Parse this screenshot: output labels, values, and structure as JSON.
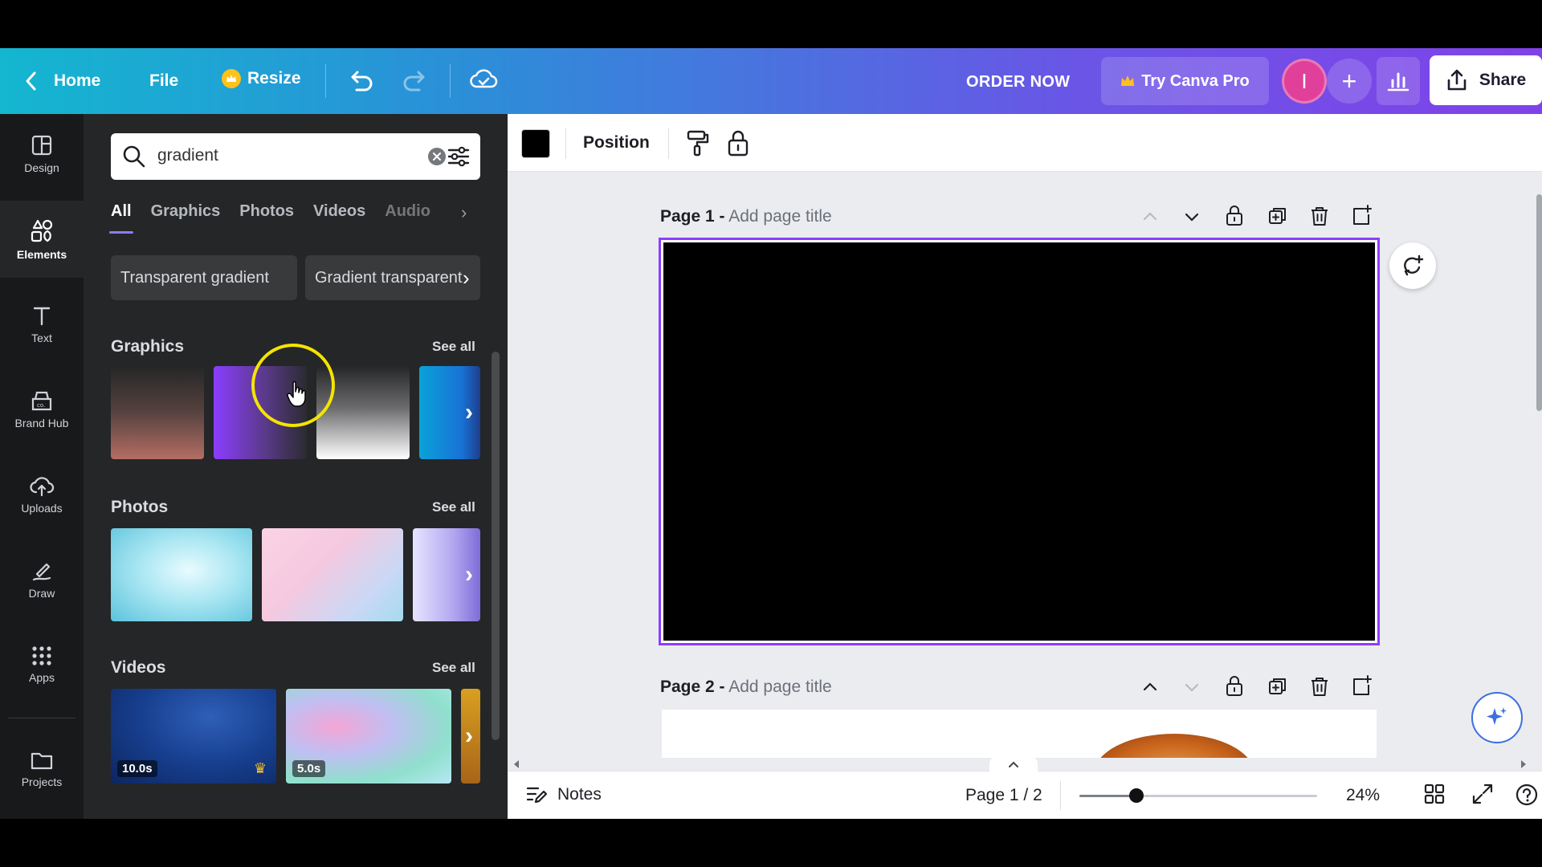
{
  "topbar": {
    "home_label": "Home",
    "file_label": "File",
    "resize_label": "Resize",
    "order_now_label": "ORDER NOW",
    "try_pro_label": "Try Canva Pro",
    "avatar_initial": "I",
    "plus_label": "+",
    "share_label": "Share"
  },
  "rail": {
    "items": [
      {
        "label": "Design",
        "icon": "layout-icon"
      },
      {
        "label": "Elements",
        "icon": "shapes-icon"
      },
      {
        "label": "Text",
        "icon": "text-icon"
      },
      {
        "label": "Brand Hub",
        "icon": "brand-icon"
      },
      {
        "label": "Uploads",
        "icon": "cloud-upload-icon"
      },
      {
        "label": "Draw",
        "icon": "pen-icon"
      },
      {
        "label": "Apps",
        "icon": "grid-icon"
      },
      {
        "label": "Projects",
        "icon": "folder-icon"
      }
    ],
    "active": "Elements"
  },
  "panel": {
    "search_value": "gradient",
    "tabs": [
      "All",
      "Graphics",
      "Photos",
      "Videos",
      "Audio"
    ],
    "active_tab": "All",
    "chips": [
      "Transparent gradient",
      "Gradient transparent"
    ],
    "sections": {
      "graphics": {
        "title": "Graphics",
        "see_all": "See all"
      },
      "photos": {
        "title": "Photos",
        "see_all": "See all"
      },
      "videos": {
        "title": "Videos",
        "see_all": "See all"
      }
    },
    "videos": [
      {
        "duration": "10.0s",
        "premium": true
      },
      {
        "duration": "5.0s",
        "premium": false
      }
    ]
  },
  "canvas": {
    "position_label": "Position",
    "swatch_color": "#000000",
    "page1": {
      "label": "Page 1 -",
      "title_placeholder": "Add page title"
    },
    "page2": {
      "label": "Page 2 -",
      "title_placeholder": "Add page title"
    }
  },
  "footer": {
    "notes_label": "Notes",
    "page_indicator": "Page 1 / 2",
    "zoom": "24%",
    "zoom_fraction": 0.24
  },
  "colors": {
    "accent": "#8b3dff",
    "brand_gradient_start": "#14b6d0",
    "brand_gradient_end": "#8042e8",
    "cursor_highlight": "#f4e400"
  }
}
